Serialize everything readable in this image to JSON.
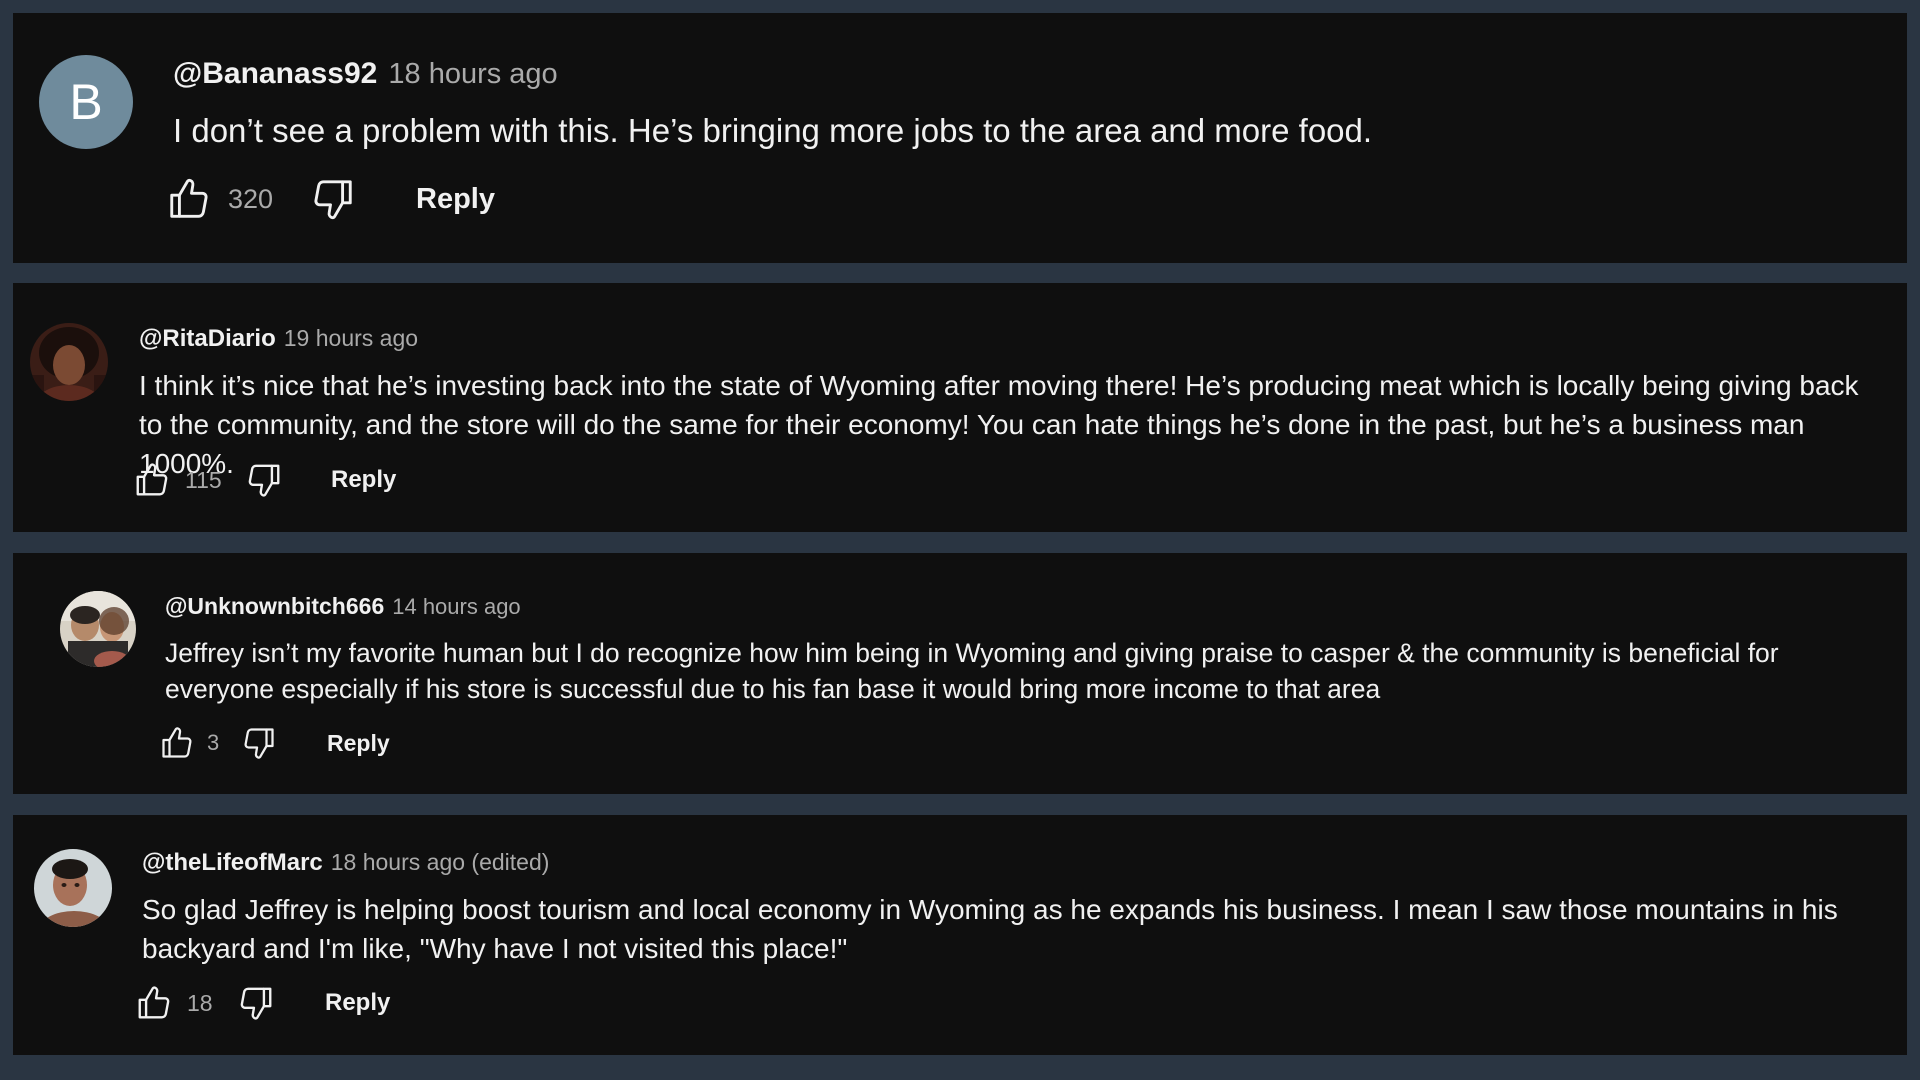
{
  "comments": [
    {
      "avatar_letter": "B",
      "avatar_color": "#6f8b9c",
      "handle": "@Bananass92",
      "time": "18 hours ago",
      "text": "I don’t see a problem with this. He’s bringing more jobs to the area and more food.",
      "likes": "320",
      "reply_label": "Reply"
    },
    {
      "handle": "@RitaDiario",
      "time": "19 hours ago",
      "text": "I think it’s nice that he’s investing back into the state of Wyoming after moving there! He’s producing meat which is locally being giving back to the community, and the store will do the same for their economy! You can hate things he’s done in the past, but he’s a business man 1000%.",
      "likes": "115",
      "reply_label": "Reply"
    },
    {
      "handle": "@Unknownbitch666",
      "time": "14 hours ago",
      "text": "Jeffrey isn’t my favorite human but  I do recognize how him being in Wyoming and giving praise to casper & the community is beneficial for everyone especially if his store is successful due to his fan base it would bring more income to that area",
      "likes": "3",
      "reply_label": "Reply"
    },
    {
      "handle": "@theLifeofMarc",
      "time": "18 hours ago (edited)",
      "text": "So glad Jeffrey is helping boost tourism and local economy in Wyoming as he expands his business. I mean I saw those mountains in his backyard and I'm like, \"Why have I not visited this place!\"",
      "likes": "18",
      "reply_label": "Reply"
    }
  ],
  "colors": {
    "page_background": "#2a3542",
    "card_background": "#0f0f0f",
    "primary_text": "#f1f1f1",
    "secondary_text": "#aaaaaa"
  },
  "icons": {
    "like": "thumbs-up-outline-icon",
    "dislike": "thumbs-down-outline-icon"
  }
}
